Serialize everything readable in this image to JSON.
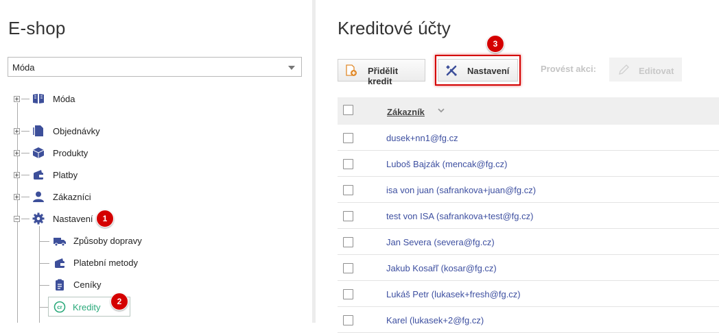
{
  "app_title": "E-shop",
  "category_select": {
    "value": "Móda"
  },
  "tree": {
    "root": {
      "label": "Móda",
      "icon": "book-icon"
    },
    "items": [
      {
        "label": "Objednávky",
        "icon": "document-icon"
      },
      {
        "label": "Produkty",
        "icon": "box-icon"
      },
      {
        "label": "Platby",
        "icon": "wallet-icon"
      },
      {
        "label": "Zákazníci",
        "icon": "user-icon"
      },
      {
        "label": "Nastavení",
        "icon": "gear-icon"
      }
    ],
    "settings_children": [
      {
        "label": "Způsoby dopravy",
        "icon": "truck-icon"
      },
      {
        "label": "Platební metody",
        "icon": "wallet-icon"
      },
      {
        "label": "Ceníky",
        "icon": "clipboard-icon"
      },
      {
        "label": "Kredity",
        "icon": "credit-icon"
      }
    ]
  },
  "badges": {
    "one": "1",
    "two": "2",
    "three": "3"
  },
  "page_title": "Kreditové účty",
  "toolbar": {
    "assign_credit": "Přidělit kredit",
    "settings": "Nastavení",
    "actions_label": "Provést akci:",
    "edit": "Editovat"
  },
  "table": {
    "column_customer": "Zákazník",
    "rows": [
      "dusek+nn1@fg.cz",
      "Luboš Bajzák (mencak@fg.cz)",
      "isa von juan (safrankova+juan@fg.cz)",
      "test von ISA (safrankova+test@fg.cz)",
      "Jan Severa (severa@fg.cz)",
      "Jakub Kosařľ (kosar@fg.cz)",
      "Lukáš Petr (lukasek+fresh@fg.cz)",
      "Karel (lukasek+2@fg.cz)"
    ]
  },
  "colors": {
    "accent": "#3d4fa0",
    "active_green": "#2aa97a",
    "badge_red": "#d40000",
    "icon_navy": "#3d4f9a"
  }
}
